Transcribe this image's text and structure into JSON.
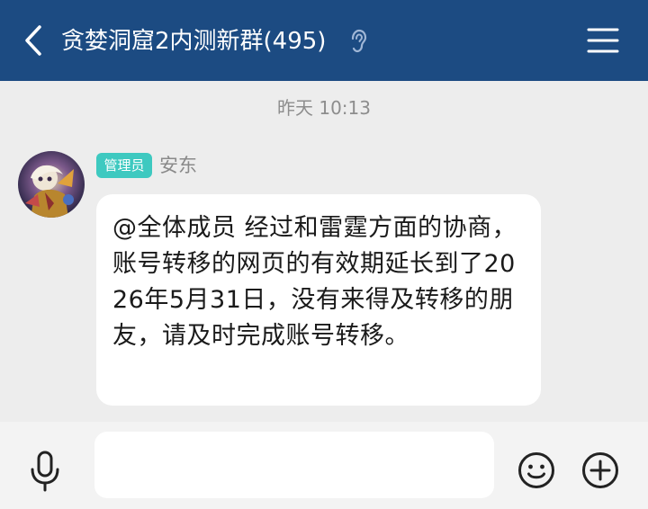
{
  "header": {
    "back_icon": "chevron-left-icon",
    "title": "贪婪洞窟2内测新群(495)",
    "ear_icon": "ear-icon",
    "menu_icon": "hamburger-menu-icon",
    "background_color": "#1c4b82"
  },
  "chat": {
    "timestamp": "昨天 10:13",
    "messages": [
      {
        "avatar_icon": "user-avatar",
        "role_badge": "管理员",
        "sender": "安东",
        "text": "@全体成员  经过和雷霆方面的协商，账号转移的网页的有效期延长到了2026年5月31日，没有来得及转移的朋友，请及时完成账号转移。"
      }
    ]
  },
  "input_bar": {
    "voice_icon": "microphone-icon",
    "message_value": "",
    "emoji_icon": "smiley-face-icon",
    "more_icon": "plus-circle-icon"
  },
  "colors": {
    "badge": "#3ec9c0",
    "background": "#ededed",
    "bubble": "#ffffff"
  }
}
